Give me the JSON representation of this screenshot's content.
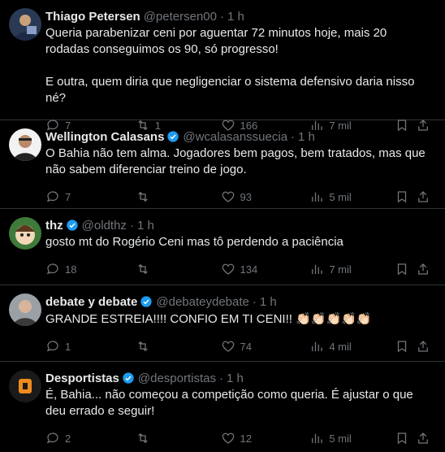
{
  "tweets": [
    {
      "name": "Thiago Petersen",
      "handle": "@petersen00",
      "time": "1 h",
      "verified": false,
      "lines": [
        "Queria parabenizar ceni por aguentar 72 minutos hoje, mais 20 rodadas conseguimos os 90, só progresso!",
        "",
        "E outra, quem diria que negligenciar o sistema defensivo daria nisso né?"
      ],
      "replies": "7",
      "retweets": "1",
      "likes": "166",
      "views": "7 mil"
    },
    {
      "name": "Wellington Calasans",
      "handle": "@wcalasanssuecia",
      "time": "1 h",
      "verified": true,
      "lines": [
        "O Bahia não tem alma. Jogadores bem pagos, bem tratados, mas que não sabem diferenciar treino de jogo."
      ],
      "replies": "7",
      "retweets": "",
      "likes": "93",
      "views": "5 mil"
    },
    {
      "name": "thz",
      "handle": "@oldthz",
      "time": "1 h",
      "verified": true,
      "lines": [
        "gosto mt do Rogério Ceni mas tô perdendo a paciência"
      ],
      "replies": "18",
      "retweets": "",
      "likes": "134",
      "views": "7 mil"
    },
    {
      "name": "debate y debate",
      "handle": "@debateydebate",
      "time": "1 h",
      "verified": true,
      "lines": [
        "GRANDE ESTREIA!!!! CONFIO EM TI CENI!!"
      ],
      "emoji": "👏🏻👏🏻👏🏻👏🏻👏🏻",
      "replies": "1",
      "retweets": "",
      "likes": "74",
      "views": "4 mil"
    },
    {
      "name": "Desportistas",
      "handle": "@desportistas",
      "time": "1 h",
      "verified": true,
      "lines": [
        "É, Bahia... não começou a competição como queria. É ajustar o que deu errado e seguir!"
      ],
      "replies": "2",
      "retweets": "",
      "likes": "12",
      "views": "5 mil"
    }
  ],
  "colors": {
    "background": "#000000",
    "text": "#e7e9ea",
    "muted": "#71767b",
    "verified": "#1d9bf0",
    "border": "#2f3336"
  },
  "icons": [
    "reply-icon",
    "retweet-icon",
    "like-icon",
    "views-icon",
    "bookmark-icon",
    "share-icon",
    "verified-badge-icon",
    "clapping-hands-emoji"
  ]
}
